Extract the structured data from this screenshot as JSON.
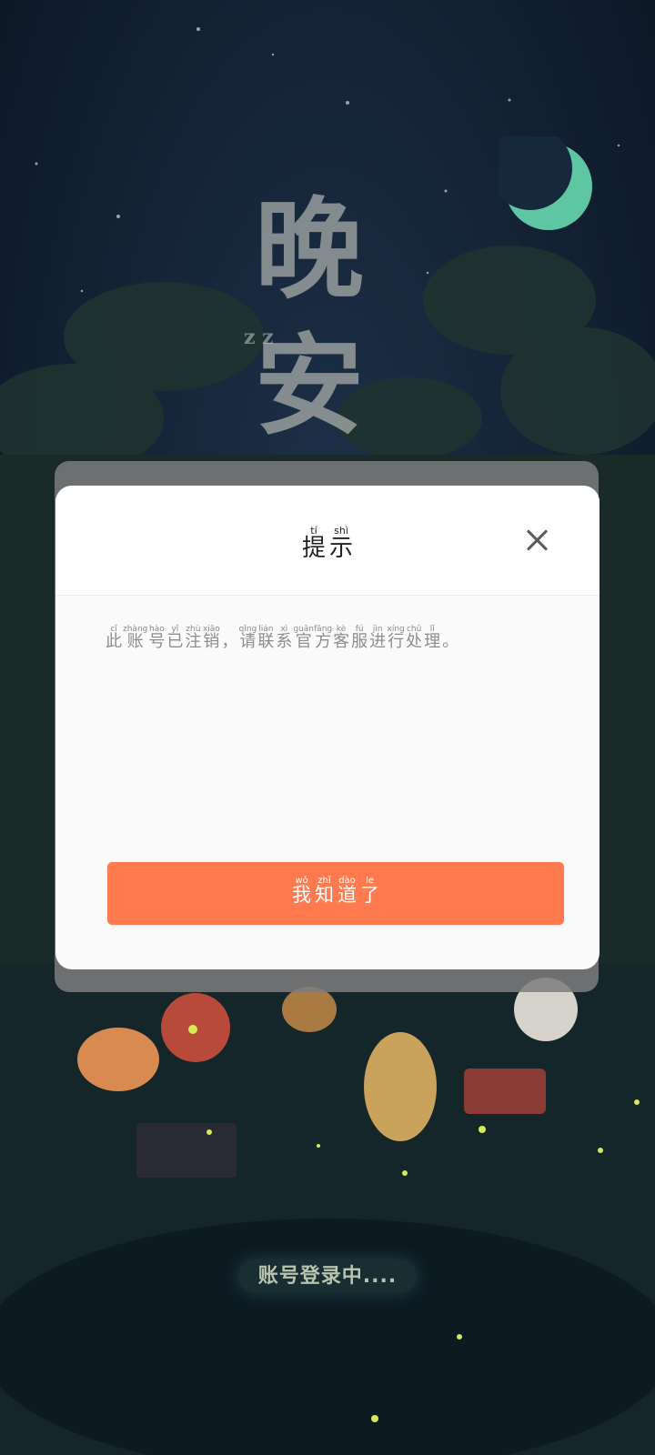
{
  "title": {
    "ruby": [
      {
        "py": "tí",
        "hz": "提"
      },
      {
        "py": "shì",
        "hz": "示"
      }
    ]
  },
  "message": {
    "ruby": [
      {
        "py": "cǐ",
        "hz": "此"
      },
      {
        "py": "zhàng",
        "hz": "账"
      },
      {
        "py": "hào",
        "hz": "号"
      },
      {
        "py": "yǐ",
        "hz": "已"
      },
      {
        "py": "zhù",
        "hz": "注"
      },
      {
        "py": "xiāo",
        "hz": "销"
      },
      {
        "py": "",
        "hz": "，"
      },
      {
        "py": "qǐng",
        "hz": "请"
      },
      {
        "py": "lián",
        "hz": "联"
      },
      {
        "py": "xì",
        "hz": "系"
      },
      {
        "py": "guān",
        "hz": "官"
      },
      {
        "py": "fāng",
        "hz": "方"
      },
      {
        "py": "kè",
        "hz": "客"
      },
      {
        "py": "fú",
        "hz": "服"
      },
      {
        "py": "jìn",
        "hz": "进"
      },
      {
        "py": "xíng",
        "hz": "行"
      },
      {
        "py": "chǔ",
        "hz": "处"
      },
      {
        "py": "lǐ",
        "hz": "理"
      },
      {
        "py": "",
        "hz": "。"
      }
    ]
  },
  "confirm_button": {
    "ruby": [
      {
        "py": "wǒ",
        "hz": "我"
      },
      {
        "py": "zhī",
        "hz": "知"
      },
      {
        "py": "dào",
        "hz": "道"
      },
      {
        "py": "le",
        "hz": "了"
      }
    ]
  },
  "background": {
    "title_art": "晚安",
    "zz_mark": "z z",
    "status_text": "账号登录中...."
  },
  "colors": {
    "button": "#ff7b4f",
    "overlay_shadow": "#7d7d7d",
    "dialog_bg": "#fafafa"
  },
  "icons": {
    "close": "close-icon",
    "moon": "moon-icon"
  }
}
